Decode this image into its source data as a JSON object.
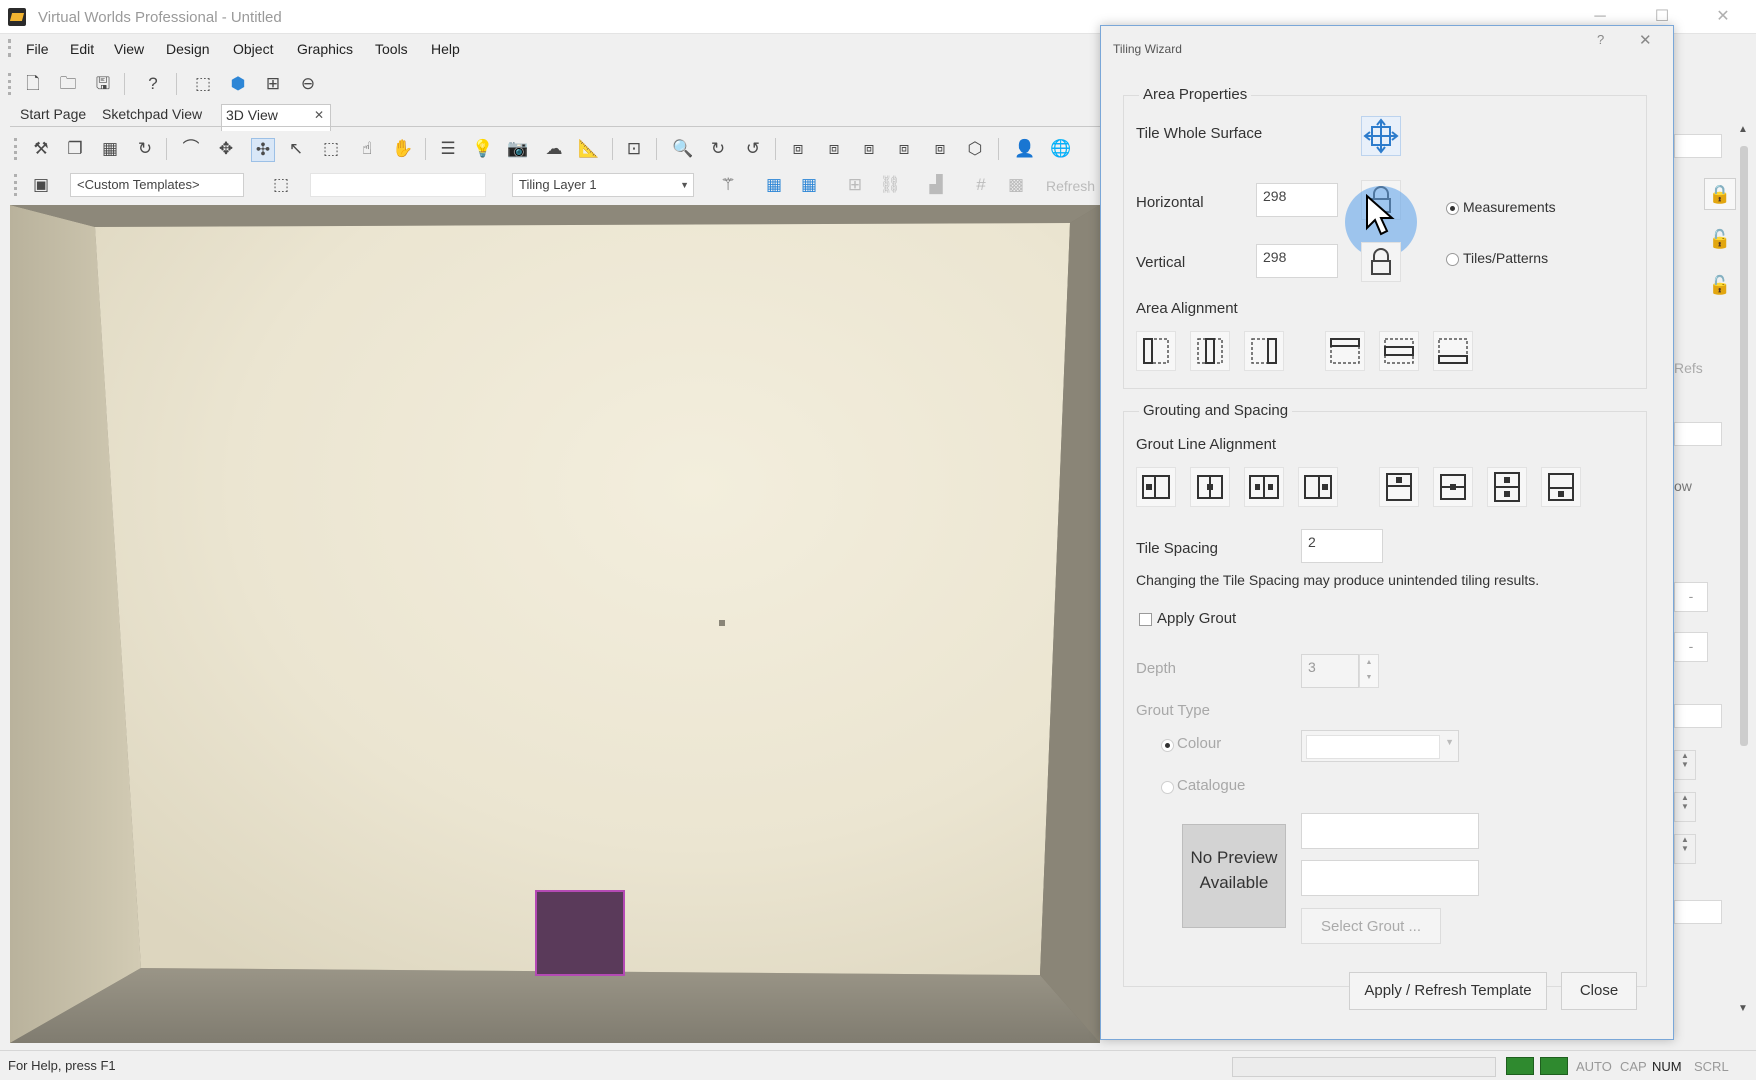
{
  "app": {
    "title": "Virtual Worlds Professional - Untitled"
  },
  "menu": {
    "items": [
      "File",
      "Edit",
      "View",
      "Design",
      "Object",
      "Graphics",
      "Tools",
      "Help"
    ]
  },
  "tabs": {
    "start_page": "Start Page",
    "sketchpad_view": "Sketchpad View",
    "view_3d": "3D View",
    "close_glyph": "✕"
  },
  "toolbar": {
    "template_combo": "<Custom Templates>",
    "layer_combo": "Tiling Layer 1",
    "refresh_label": "Refresh"
  },
  "dialog": {
    "title": "Tiling Wizard",
    "help_glyph": "?",
    "close_glyph": "✕",
    "area_properties": {
      "group_title": "Area Properties",
      "tile_whole_surface": "Tile Whole Surface",
      "horizontal_label": "Horizontal",
      "horizontal_value": "298",
      "vertical_label": "Vertical",
      "vertical_value": "298",
      "option_measurements": "Measurements",
      "option_tiles_patterns": "Tiles/Patterns",
      "area_alignment": "Area Alignment"
    },
    "grouting": {
      "group_title": "Grouting and Spacing",
      "grout_line_alignment": "Grout Line Alignment",
      "tile_spacing_label": "Tile Spacing",
      "tile_spacing_value": "2",
      "warning": "Changing the Tile Spacing may produce unintended tiling results.",
      "apply_grout": "Apply Grout",
      "depth_label": "Depth",
      "depth_value": "3",
      "grout_type": "Grout Type",
      "colour": "Colour",
      "catalogue": "Catalogue",
      "preview_text": "No Preview Available",
      "select_grout": "Select Grout ..."
    },
    "apply_refresh": "Apply / Refresh Template",
    "close_button": "Close"
  },
  "behind_panel": {
    "refs_label": "Refs",
    "ow_label": "ow"
  },
  "statusbar": {
    "help_text": "For Help, press F1",
    "auto": "AUTO",
    "cap": "CAP",
    "num": "NUM",
    "scrl": "SCRL"
  },
  "colors": {
    "wall": "#e9e3cf",
    "floor": "#8c887c",
    "selected_tile": "#5a3a5a",
    "selected_tile_border": "#b44ab4",
    "accent": "#3e8ed8"
  }
}
